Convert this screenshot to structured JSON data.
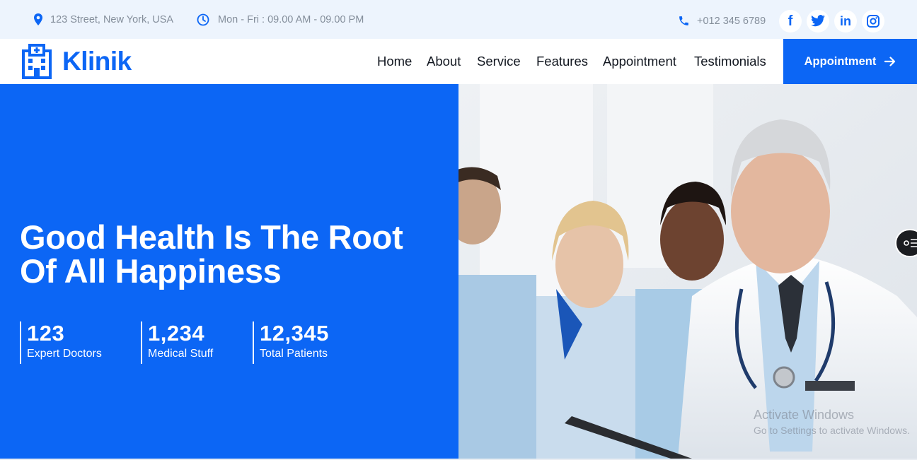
{
  "topbar": {
    "address": "123 Street, New York, USA",
    "hours": "Mon - Fri : 09.00 AM - 09.00 PM",
    "phone": "+012 345 6789",
    "social": [
      {
        "name": "facebook-icon",
        "glyph": "f"
      },
      {
        "name": "twitter-icon",
        "glyph": ""
      },
      {
        "name": "linkedin-icon",
        "glyph": "in"
      },
      {
        "name": "instagram-icon",
        "glyph": ""
      }
    ]
  },
  "brand": {
    "name": "Klinik",
    "accent": "#0c66f5"
  },
  "nav": {
    "links": [
      "Home",
      "About",
      "Service",
      "Features",
      "Appointment",
      "Testimonials"
    ],
    "cta": "Appointment"
  },
  "hero": {
    "title_line1": "Good Health Is The Root",
    "title_line2": "Of All Happiness",
    "stats": [
      {
        "value": "123",
        "label": "Expert Doctors"
      },
      {
        "value": "1,234",
        "label": "Medical Stuff"
      },
      {
        "value": "12,345",
        "label": "Total Patients"
      }
    ]
  },
  "watermark": {
    "title": "Activate Windows",
    "subtitle": "Go to Settings to activate Windows."
  }
}
